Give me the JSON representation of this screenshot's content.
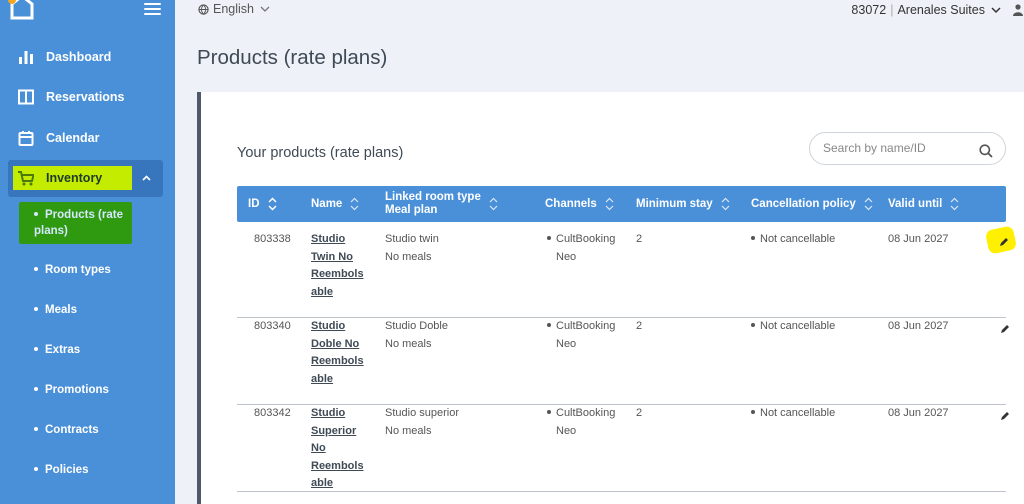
{
  "sidebar": {
    "items": [
      {
        "label": "Dashboard",
        "icon": "bar-chart-icon"
      },
      {
        "label": "Reservations",
        "icon": "book-icon"
      },
      {
        "label": "Calendar",
        "icon": "calendar-icon"
      },
      {
        "label": "Inventory",
        "icon": "cart-icon"
      }
    ],
    "inventory_sub": [
      {
        "label": "Products (rate plans)"
      },
      {
        "label": "Room types"
      },
      {
        "label": "Meals"
      },
      {
        "label": "Extras"
      },
      {
        "label": "Promotions"
      },
      {
        "label": "Contracts"
      },
      {
        "label": "Policies"
      }
    ]
  },
  "topbar": {
    "language": "English",
    "property_id": "83072",
    "property_name": "Arenales Suites"
  },
  "page_title": "Products (rate plans)",
  "card": {
    "title": "Your products (rate plans)",
    "search_placeholder": "Search by name/ID"
  },
  "table": {
    "headers": {
      "id": "ID",
      "name": "Name",
      "linked_1": "Linked room type",
      "linked_2": "Meal plan",
      "channels": "Channels",
      "min_stay": "Minimum stay",
      "cancel": "Cancellation policy",
      "valid": "Valid until"
    },
    "rows": [
      {
        "id": "803338",
        "name": [
          "Studio",
          "Twin No",
          "Reembols",
          "able"
        ],
        "room": "Studio twin",
        "meal": "No meals",
        "channel_1": "CultBooking",
        "channel_2": "Neo",
        "min_stay": "2",
        "cancel": "Not cancellable",
        "valid": "08 Jun 2027"
      },
      {
        "id": "803340",
        "name": [
          "Studio",
          "Doble No",
          "Reembols",
          "able"
        ],
        "room": "Studio Doble",
        "meal": "No meals",
        "channel_1": "CultBooking",
        "channel_2": "Neo",
        "min_stay": "2",
        "cancel": "Not cancellable",
        "valid": "08 Jun 2027"
      },
      {
        "id": "803342",
        "name": [
          "Studio",
          "Superior",
          "No",
          "Reembols",
          "able"
        ],
        "room": "Studio superior",
        "meal": "No meals",
        "channel_1": "CultBooking",
        "channel_2": "Neo",
        "min_stay": "2",
        "cancel": "Not cancellable",
        "valid": "08 Jun 2027"
      }
    ]
  },
  "colors": {
    "sidebar": "#4a90d9",
    "highlight_yellow_green": "#c3ec00",
    "highlight_green": "#2f9a10",
    "highlight_yellow": "#ffef00"
  }
}
